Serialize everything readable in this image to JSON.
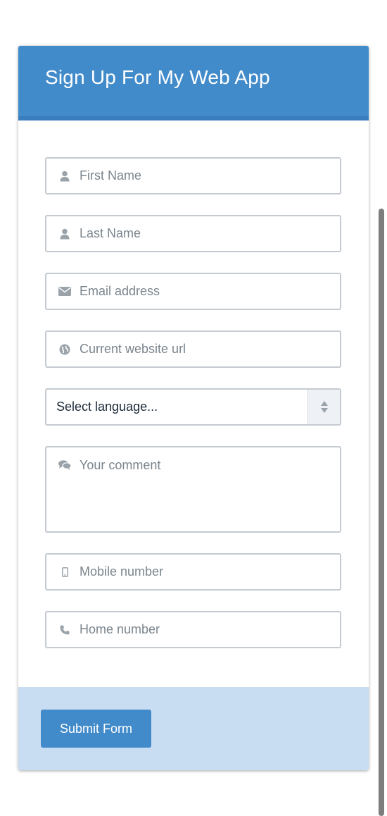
{
  "header": {
    "title": "Sign Up For My Web App"
  },
  "form": {
    "first_name": {
      "placeholder": "First Name",
      "icon": "user-icon"
    },
    "last_name": {
      "placeholder": "Last Name",
      "icon": "user-icon"
    },
    "email": {
      "placeholder": "Email address",
      "icon": "envelope-icon"
    },
    "website": {
      "placeholder": "Current website url",
      "icon": "globe-icon"
    },
    "language": {
      "selected": "Select language...",
      "icon": "up-down-arrows-icon"
    },
    "comment": {
      "placeholder": "Your comment",
      "icon": "comments-icon"
    },
    "mobile": {
      "placeholder": "Mobile number",
      "icon": "mobile-phone-icon"
    },
    "home": {
      "placeholder": "Home number",
      "icon": "phone-icon"
    }
  },
  "footer": {
    "submit_label": "Submit Form"
  },
  "colors": {
    "accent": "#428bca",
    "footer_bg": "#c9ddf2",
    "field_border": "#c5cbd0",
    "icon": "#9aa3aa"
  }
}
